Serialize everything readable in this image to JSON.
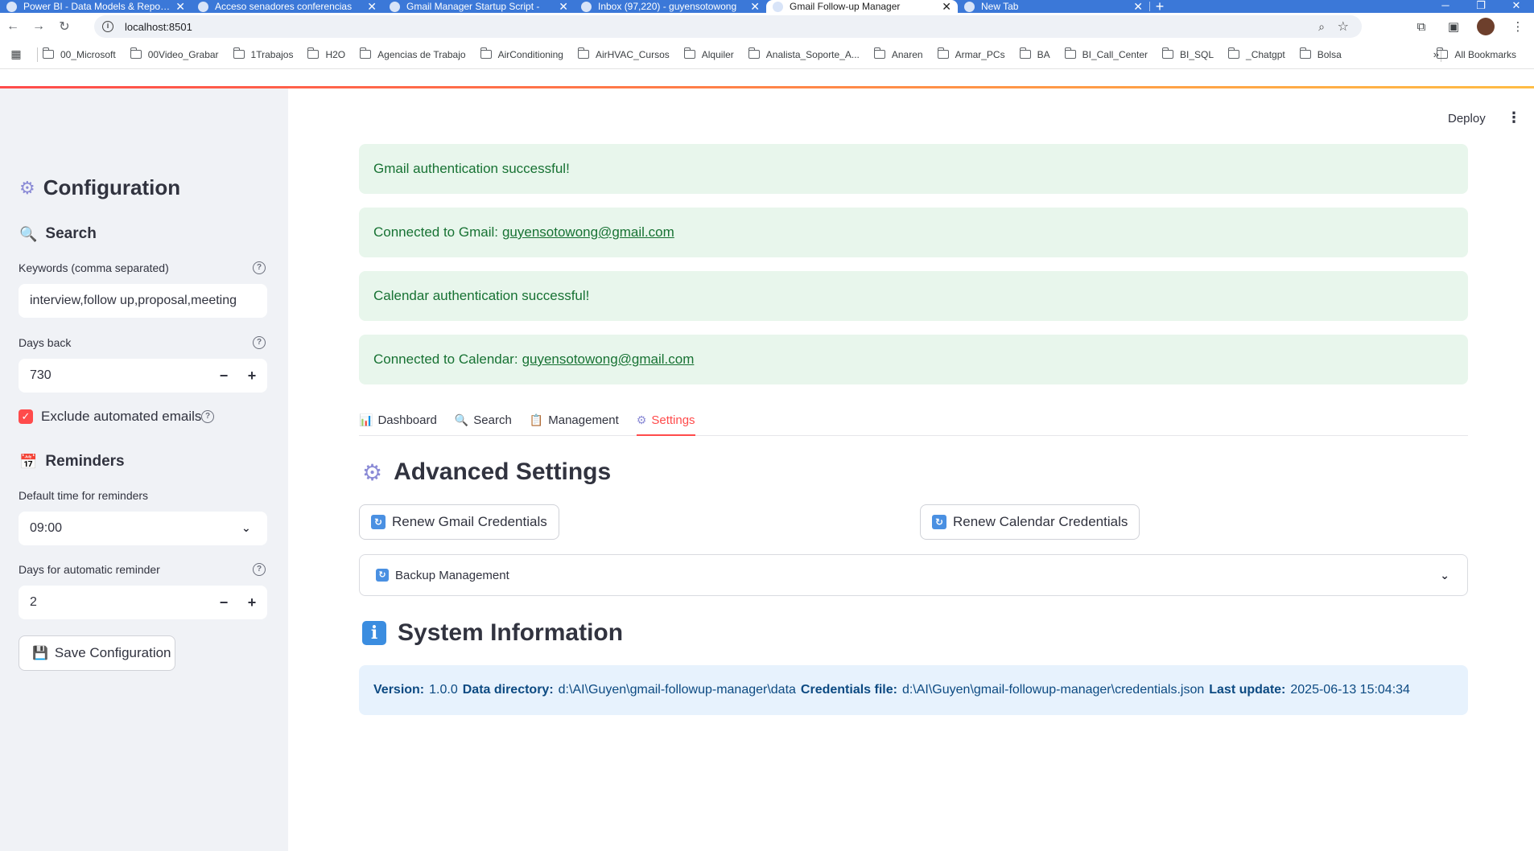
{
  "browser": {
    "tabs": [
      {
        "title": "Power BI - Data Models & Reports",
        "active": false
      },
      {
        "title": "Acceso senadores conferencias",
        "active": false
      },
      {
        "title": "Gmail Manager Startup Script -",
        "active": false
      },
      {
        "title": "Inbox (97,220) - guyensotowong",
        "active": false
      },
      {
        "title": "Gmail Follow-up Manager",
        "active": true
      },
      {
        "title": "New Tab",
        "active": false
      }
    ],
    "url": "localhost:8501",
    "bookmarks": [
      "00_Microsoft",
      "00Video_Grabar",
      "1Trabajos",
      "H2O",
      "Agencias de Trabajo",
      "AirConditioning",
      "AirHVAC_Cursos",
      "Alquiler",
      "Analista_Soporte_A...",
      "Anaren",
      "Armar_PCs",
      "BA",
      "BI_Call_Center",
      "BI_SQL",
      "_Chatgpt",
      "Bolsa"
    ],
    "all_bookmarks": "All Bookmarks",
    "more": "»"
  },
  "sidebar": {
    "title": "Configuration",
    "search_header": "Search",
    "keywords_label": "Keywords (comma separated)",
    "keywords_value": "interview,follow up,proposal,meeting",
    "days_back_label": "Days back",
    "days_back_value": "730",
    "exclude_label": "Exclude automated emails",
    "reminders_header": "Reminders",
    "default_time_label": "Default time for reminders",
    "default_time_value": "09:00",
    "days_reminder_label": "Days for automatic reminder",
    "days_reminder_value": "2",
    "save_button": "Save Configuration"
  },
  "header": {
    "deploy": "Deploy"
  },
  "alerts": {
    "gmail_auth": "Gmail authentication successful!",
    "gmail_connected_prefix": "Connected to Gmail:",
    "gmail_email": "guyensotowong@gmail.com",
    "calendar_auth": "Calendar authentication successful!",
    "calendar_connected_prefix": "Connected to Calendar:",
    "calendar_email": "guyensotowong@gmail.com"
  },
  "tabs": [
    {
      "label": "Dashboard",
      "icon": "📊"
    },
    {
      "label": "Search",
      "icon": "🔍"
    },
    {
      "label": "Management",
      "icon": "📋"
    },
    {
      "label": "Settings",
      "icon": "⚙"
    }
  ],
  "advanced": {
    "title": "Advanced Settings",
    "renew_gmail": "Renew Gmail Credentials",
    "renew_calendar": "Renew Calendar Credentials",
    "backup": "Backup Management"
  },
  "system": {
    "title": "System Information",
    "version_label": "Version:",
    "version": "1.0.0",
    "data_dir_label": "Data directory:",
    "data_dir": "d:\\AI\\Guyen\\gmail-followup-manager\\data",
    "cred_label": "Credentials file:",
    "cred_file": "d:\\AI\\Guyen\\gmail-followup-manager\\credentials.json",
    "update_label": "Last update:",
    "update": "2025-06-13 15:04:34"
  },
  "colors": {
    "accent": "#ff4b4b",
    "success_bg": "#e8f6ec",
    "success_text": "#177233",
    "info_bg": "#e7f2fd",
    "info_text": "#0c4a82",
    "sidebar_bg": "#f0f2f6",
    "chrome_blue": "#3b78d8"
  }
}
